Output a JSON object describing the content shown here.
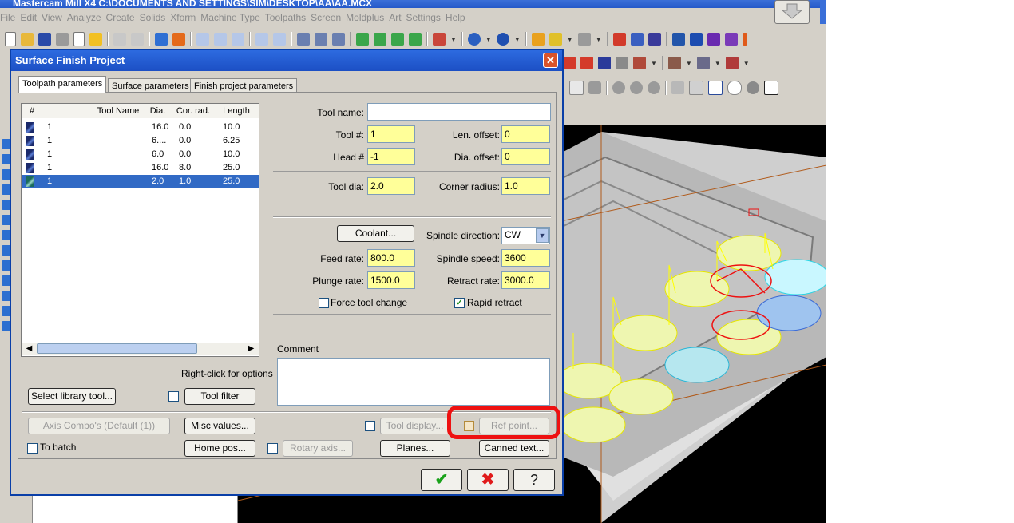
{
  "app": {
    "title": "Mastercam Mill X4  C:\\DOCUMENTS AND SETTINGS\\SIM\\DESKTOP\\AA\\AA.MCX",
    "menu": [
      "File",
      "Edit",
      "View",
      "Analyze",
      "Create",
      "Solids",
      "Xform",
      "Machine Type",
      "Toolpaths",
      "Screen",
      "Moldplus",
      "Art",
      "Settings",
      "Help"
    ]
  },
  "dialog": {
    "title": "Surface Finish Project",
    "close_glyph": "✕",
    "tabs": [
      "Toolpath parameters",
      "Surface parameters",
      "Finish project parameters"
    ],
    "tool_table": {
      "columns": [
        "#",
        "Tool Name",
        "Dia.",
        "Cor. rad.",
        "Length"
      ],
      "rows": [
        {
          "num": "1",
          "name": "",
          "dia": "16.0",
          "cor": "0.0",
          "len": "10.0"
        },
        {
          "num": "1",
          "name": "",
          "dia": "6....",
          "cor": "0.0",
          "len": "6.25"
        },
        {
          "num": "1",
          "name": "",
          "dia": "6.0",
          "cor": "0.0",
          "len": "10.0"
        },
        {
          "num": "1",
          "name": "",
          "dia": "16.0",
          "cor": "8.0",
          "len": "25.0"
        },
        {
          "num": "1",
          "name": "",
          "dia": "2.0",
          "cor": "1.0",
          "len": "25.0"
        }
      ]
    },
    "right_click_hint": "Right-click for options",
    "fields": {
      "tool_name_label": "Tool name:",
      "tool_name_value": "",
      "tool_num_label": "Tool #:",
      "tool_num_value": "1",
      "len_offset_label": "Len. offset:",
      "len_offset_value": "0",
      "head_label": "Head #",
      "head_value": "-1",
      "dia_offset_label": "Dia. offset:",
      "dia_offset_value": "0",
      "tool_dia_label": "Tool dia:",
      "tool_dia_value": "2.0",
      "corner_radius_label": "Corner radius:",
      "corner_radius_value": "1.0",
      "spindle_dir_label": "Spindle direction:",
      "spindle_dir_value": "CW",
      "feed_rate_label": "Feed rate:",
      "feed_rate_value": "800.0",
      "spindle_speed_label": "Spindle speed:",
      "spindle_speed_value": "3600",
      "plunge_rate_label": "Plunge rate:",
      "plunge_rate_value": "1500.0",
      "retract_rate_label": "Retract rate:",
      "retract_rate_value": "3000.0",
      "comment_label": "Comment",
      "comment_value": ""
    },
    "checkboxes": {
      "force_tool_change": "Force tool change",
      "rapid_retract": "Rapid retract",
      "rapid_retract_check": "✓",
      "to_batch": "To batch"
    },
    "buttons": {
      "coolant": "Coolant...",
      "select_library": "Select library tool...",
      "tool_filter": "Tool filter",
      "axis_combo": "Axis Combo's (Default (1))",
      "misc_values": "Misc values...",
      "tool_display": "Tool display...",
      "ref_point": "Ref point...",
      "home_pos": "Home pos...",
      "rotary_axis": "Rotary axis...",
      "planes": "Planes...",
      "canned_text": "Canned text..."
    },
    "footer": {
      "ok_glyph": "✔",
      "cancel_glyph": "✖",
      "help_glyph": "?"
    }
  },
  "colors": {
    "title_blue": "#2459c9",
    "field_yellow": "#ffff99",
    "selection": "#316ac5",
    "highlight_red": "#ee1111",
    "toolpath_yellow": "#ffff00"
  }
}
